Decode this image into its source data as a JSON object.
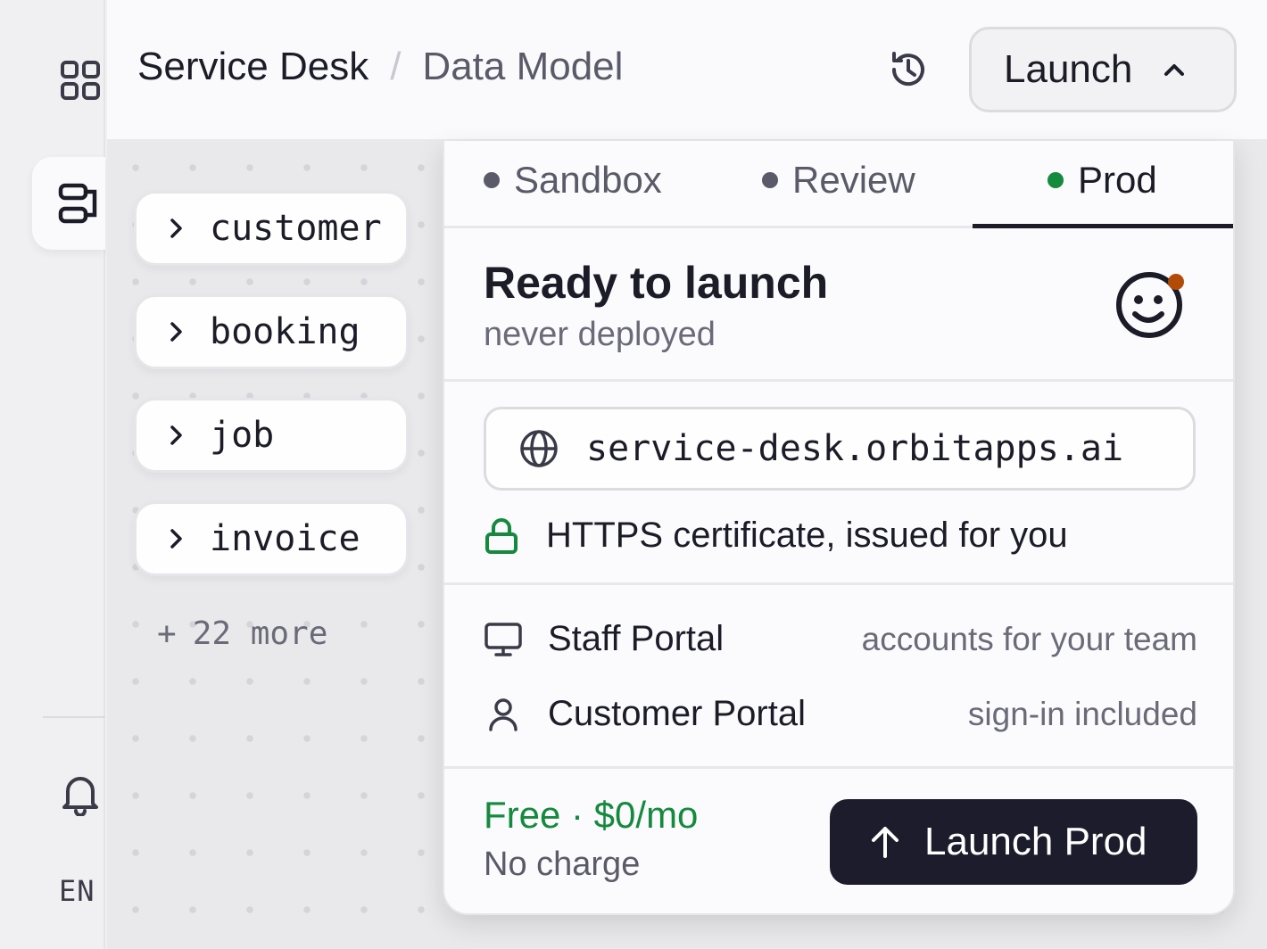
{
  "rail": {
    "lang": "EN"
  },
  "header": {
    "breadcrumb_app": "Service Desk",
    "breadcrumb_sep": "/",
    "breadcrumb_page": "Data Model",
    "launch_label": "Launch"
  },
  "canvas": {
    "entities": [
      "customer",
      "booking",
      "job",
      "invoice"
    ],
    "more_prefix": "+",
    "more_label": "22 more"
  },
  "panel": {
    "tabs": [
      {
        "label": "Sandbox",
        "active": false
      },
      {
        "label": "Review",
        "active": false
      },
      {
        "label": "Prod",
        "active": true
      }
    ],
    "status_title": "Ready to launch",
    "status_sub": "never deployed",
    "url": "service-desk.orbitapps.ai",
    "https_note": "HTTPS certificate, issued for you",
    "portals": [
      {
        "icon": "monitor-icon",
        "name": "Staff Portal",
        "desc": "accounts for your team"
      },
      {
        "icon": "user-icon",
        "name": "Customer Portal",
        "desc": "sign-in included"
      }
    ],
    "price": "Free · $0/mo",
    "charge": "No charge",
    "cta_label": "Launch Prod"
  },
  "colors": {
    "accent_green": "#138a3c",
    "dark_button": "#1c1c2c",
    "badge_orange": "#b34a06"
  }
}
